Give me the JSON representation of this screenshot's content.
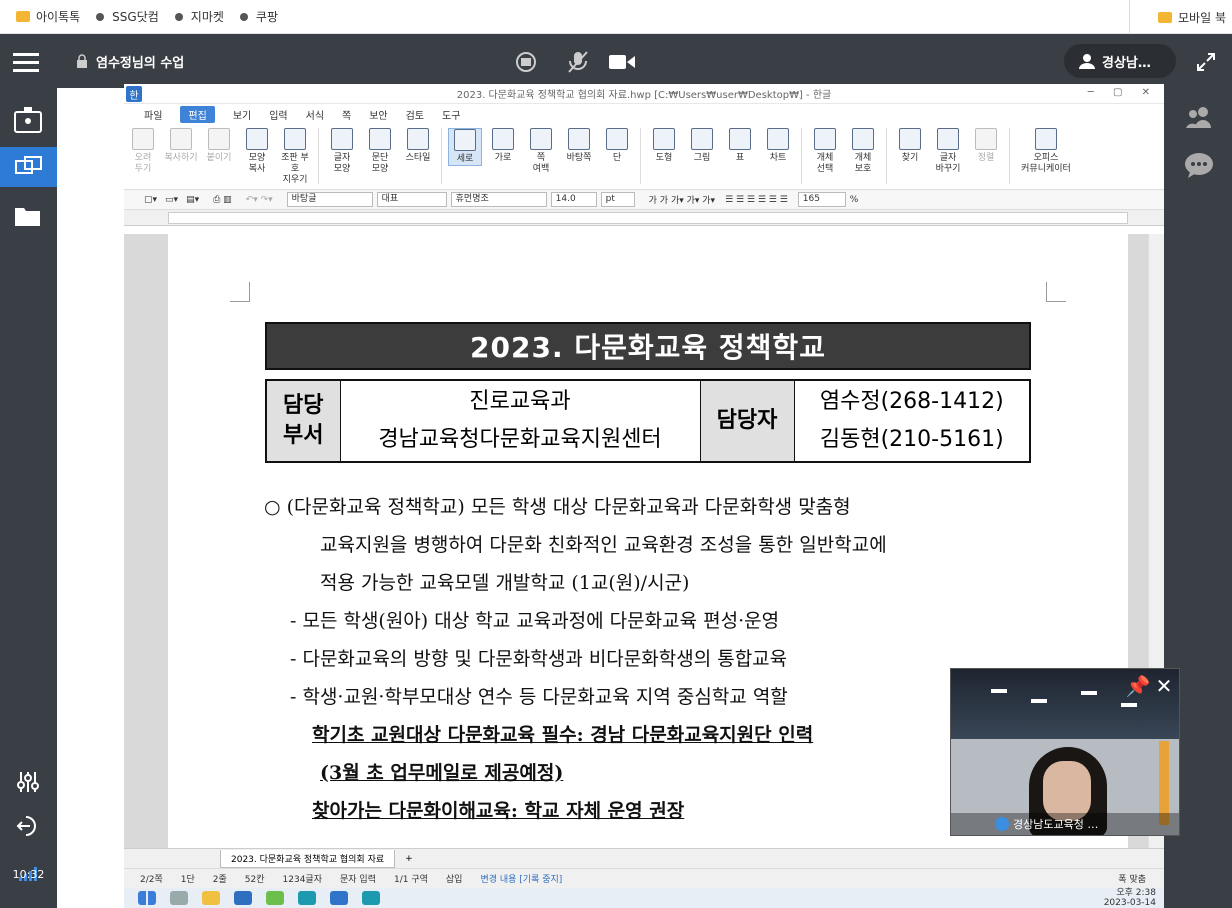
{
  "bookmarks": {
    "items": [
      {
        "label": "아이톡톡",
        "kind": "folder"
      },
      {
        "label": "SSG닷컴",
        "kind": "dot"
      },
      {
        "label": "지마켓",
        "kind": "dot"
      },
      {
        "label": "쿠팡",
        "kind": "dot"
      }
    ],
    "right_label": "모바일 북"
  },
  "meeting": {
    "title": "염수정님의 수업",
    "presenter": "경상남…",
    "clock": "10:32"
  },
  "hwp": {
    "window_title": "2023. 다문화교육 정책학교 협의회 자료.hwp [C:₩Users₩user₩Desktop₩] - 한글",
    "menus": [
      "파일",
      "편집",
      "보기",
      "입력",
      "서식",
      "쪽",
      "보안",
      "검토",
      "도구"
    ],
    "active_menu": "편집",
    "ribbon": [
      {
        "label": "오려\n두기",
        "disabled": true
      },
      {
        "label": "복사하기",
        "disabled": true
      },
      {
        "label": "붙이기",
        "disabled": true
      },
      {
        "label": "모양\n복사",
        "disabled": false
      },
      {
        "label": "조판 부호\n지우기",
        "disabled": false
      },
      {
        "label": "글자\n모양",
        "disabled": false
      },
      {
        "label": "문단\n모양",
        "disabled": false
      },
      {
        "label": "스타일",
        "disabled": false
      },
      {
        "label": "세로",
        "disabled": false,
        "selected": true
      },
      {
        "label": "가로",
        "disabled": false
      },
      {
        "label": "쪽\n여백",
        "disabled": false
      },
      {
        "label": "바탕쪽",
        "disabled": false
      },
      {
        "label": "단",
        "disabled": false
      },
      {
        "label": "도형",
        "disabled": false
      },
      {
        "label": "그림",
        "disabled": false
      },
      {
        "label": "표",
        "disabled": false
      },
      {
        "label": "차트",
        "disabled": false
      },
      {
        "label": "개체\n선택",
        "disabled": false
      },
      {
        "label": "개체\n보호",
        "disabled": false
      },
      {
        "label": "찾기",
        "disabled": false
      },
      {
        "label": "글자\n바꾸기",
        "disabled": false
      },
      {
        "label": "정렬",
        "disabled": true
      },
      {
        "label": "오피스\n커뮤니케이터",
        "disabled": false
      }
    ],
    "format": {
      "style": "바탕글",
      "lang": "대표",
      "font": "휴먼명조",
      "size": "14.0",
      "unit": "pt",
      "zoom": "165",
      "zoom_unit": "%"
    },
    "document": {
      "title": "2023. 다문화교육 정책학교",
      "dept_header": "담당\n부서",
      "dept_line1": "진로교육과",
      "dept_line2": "경남교육청다문화교육지원센터",
      "person_header": "담당자",
      "person_line1": "염수정(268-1412)",
      "person_line2": "김동현(210-5161)",
      "lines": [
        "○  (다문화교육 정책학교) 모든 학생 대상 다문화교육과 다문화학생 맞춤형",
        "교육지원을 병행하여 다문화 친화적인 교육환경 조성을 통한 일반학교에",
        "적용 가능한 교육모델 개발학교 (1교(원)/시군)",
        "- 모든 학생(원아) 대상 학교 교육과정에 다문화교육 편성·운영",
        "- 다문화교육의 방향 및 다문화학생과 비다문화학생의 통합교육",
        "- 학생·교원·학부모대상 연수 등 다문화교육 지역 중심학교 역할",
        "학기초 교원대상 다문화교육 필수: 경남 다문화교육지원단 인력",
        "(3월 초 업무메일로 제공예정)",
        "찾아가는 다문화이해교육: 학교 자체 운영 권장"
      ]
    },
    "tab_label": "2023. 다문화교육 정책학교 협의회 자료",
    "status": [
      "2/2쪽",
      "1단",
      "2줄",
      "52칸",
      "1234글자",
      "문자 입력",
      "1/1 구역",
      "삽입",
      "변경 내용 [기록 중지]"
    ],
    "status_right": "폭 맞춤"
  },
  "video": {
    "name": "경상남도교육청 …"
  },
  "taskbar": {
    "time": "오후 2:38",
    "date": "2023-03-14"
  }
}
